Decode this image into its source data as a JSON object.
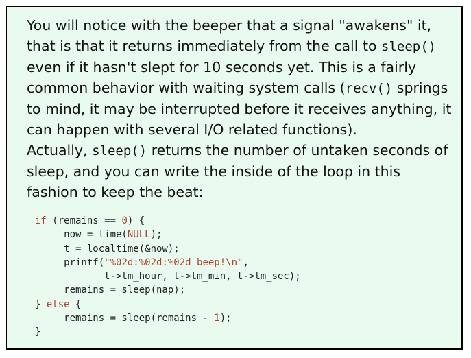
{
  "paragraph1": {
    "t1": "You will notice with the beeper that a signal \"awakens\" it, that is that it returns immediately from the call to ",
    "c1": "sleep()",
    "t2": " even if it hasn't slept for 10 seconds yet. This is a fairly common behavior with waiting system calls (",
    "c2": "recv()",
    "t3": " springs to mind, it may be interrupted before it receives anything, it can happen with several I/O related functions)."
  },
  "paragraph2": {
    "t1": "Actually, ",
    "c1": "sleep()",
    "t2": " returns the number of untaken seconds of sleep, and you can write the inside of the loop in this fashion to keep the beat:"
  },
  "code": {
    "l1_kw": "if",
    "l1_a": " (remains == ",
    "l1_num": "0",
    "l1_b": ") {",
    "l2_a": "     now = time(",
    "l2_kw": "NULL",
    "l2_b": ");",
    "l3": "     t = localtime(&now);",
    "l4_a": "     printf(",
    "l4_str": "\"%02d:%02d:%02d beep!\\n\"",
    "l4_b": ",",
    "l5": "            t->tm_hour, t->tm_min, t->tm_sec);",
    "l6": "     remains = sleep(nap);",
    "l7_a": "} ",
    "l7_kw": "else",
    "l7_b": " {",
    "l8_a": "     remains = sleep(remains - ",
    "l8_num": "1",
    "l8_b": ");",
    "l9": "}"
  }
}
